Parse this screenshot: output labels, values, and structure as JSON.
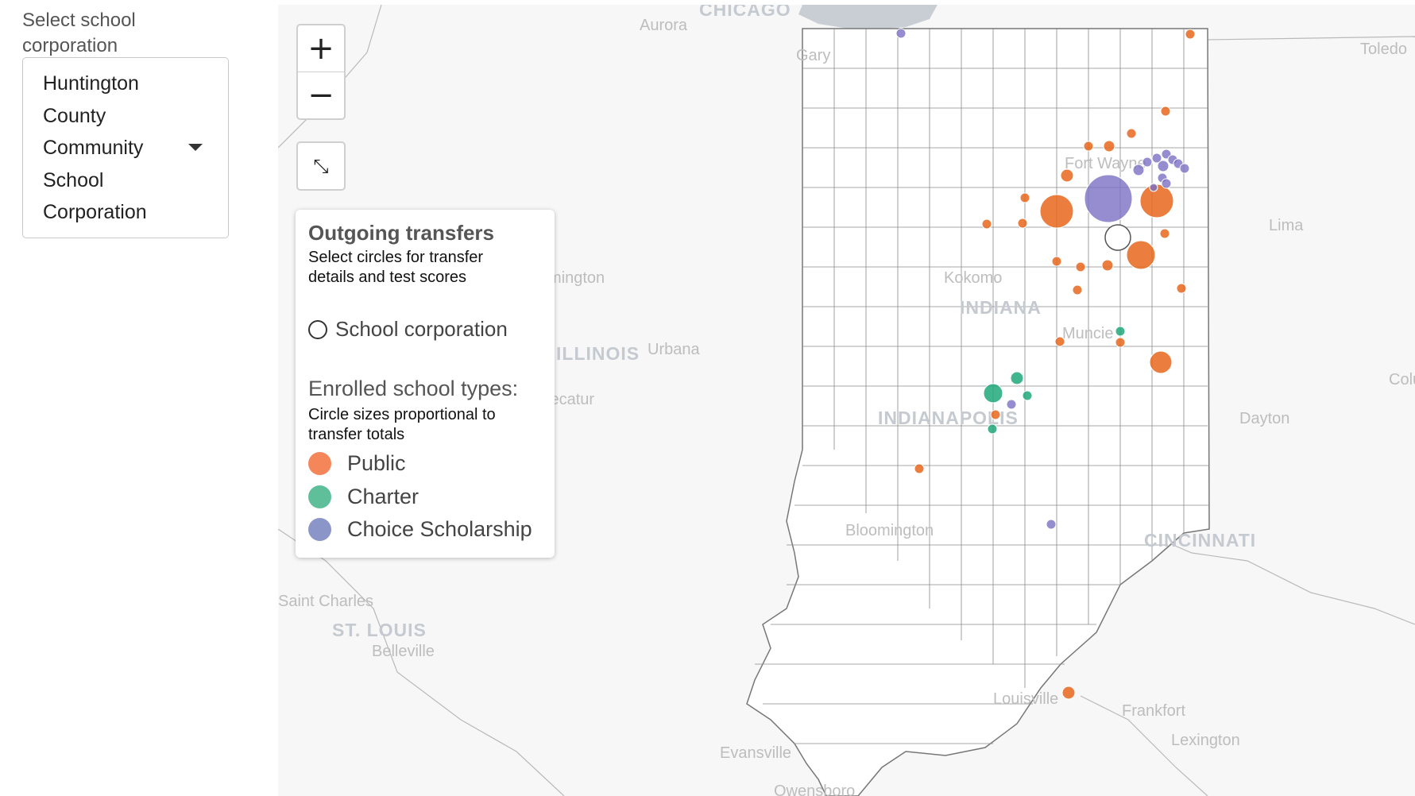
{
  "selector": {
    "label": "Select school corporation",
    "value": "Huntington County Community School Corporation"
  },
  "controls": {
    "zoom_in": "+",
    "zoom_out": "−",
    "fit": "⤡"
  },
  "legend": {
    "title": "Outgoing transfers",
    "subtitle": "Select circles for transfer details and test scores",
    "school_corporation": "School corporation",
    "types_title": "Enrolled school types:",
    "types_subtitle": "Circle sizes proportional to transfer totals",
    "types": [
      {
        "label": "Public",
        "color": "#f4865a"
      },
      {
        "label": "Charter",
        "color": "#5fbf9b"
      },
      {
        "label": "Choice Scholarship",
        "color": "#8c95c8"
      }
    ]
  },
  "map_labels": {
    "cities": [
      "CHICAGO",
      "Aurora",
      "Gary",
      "Toledo",
      "Lima",
      "Kokomo",
      "Fort Wayne",
      "Muncie",
      "Urbana",
      "Decatur",
      "Bloomington",
      "Dayton",
      "Columbus",
      "Bloomington",
      "Saint Charles",
      "Belleville",
      "Louisville",
      "Frankfort",
      "Lexington",
      "Evansville",
      "Owensboro",
      "Cincinnati"
    ],
    "regions": [
      "INDIANA",
      "ILLINOIS",
      "INDIANAPOLIS",
      "ST. LOUIS",
      "CINCINNATI"
    ]
  },
  "map_colors": {
    "public": "#e8671c",
    "charter": "#1fa87a",
    "choice": "#7b70c4",
    "lake": "#c9ced4"
  }
}
